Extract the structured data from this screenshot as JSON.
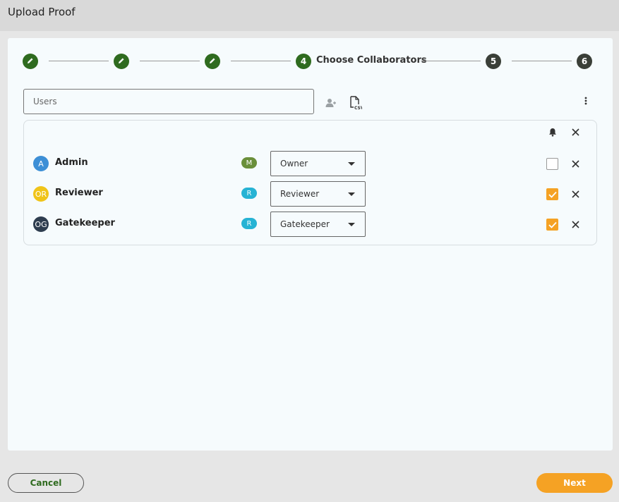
{
  "window": {
    "title": "Upload Proof"
  },
  "stepper": {
    "steps": [
      {
        "number": "1",
        "state": "done",
        "icon": "pencil-icon"
      },
      {
        "number": "2",
        "state": "done",
        "icon": "pencil-icon"
      },
      {
        "number": "3",
        "state": "done",
        "icon": "pencil-icon"
      },
      {
        "number": "4",
        "state": "current",
        "label": "Choose Collaborators"
      },
      {
        "number": "5",
        "state": "todo"
      },
      {
        "number": "6",
        "state": "todo"
      }
    ]
  },
  "search": {
    "placeholder": "Users"
  },
  "toolbar": {
    "icons": [
      "add-user-icon",
      "csv-file-icon",
      "more-vertical-icon"
    ]
  },
  "panel": {
    "header_icons": [
      "bell-icon",
      "close-icon"
    ],
    "collaborators": [
      {
        "initials": "A",
        "name": "Admin",
        "avatar_color": "#3d8fd6",
        "badge": "M",
        "badge_color": "#6a8f3a",
        "role": "Owner",
        "notify": false
      },
      {
        "initials": "OR",
        "name": "Reviewer",
        "avatar_color": "#f0c419",
        "badge": "R",
        "badge_color": "#27b3d4",
        "role": "Reviewer",
        "notify": true
      },
      {
        "initials": "OG",
        "name": "Gatekeeper",
        "avatar_color": "#2e3d4f",
        "badge": "R",
        "badge_color": "#27b3d4",
        "role": "Gatekeeper",
        "notify": true
      }
    ]
  },
  "footer": {
    "cancel_label": "Cancel",
    "next_label": "Next"
  },
  "colors": {
    "accent": "#f5a224",
    "step_done": "#2f6b1f",
    "step_todo": "#3a3f38"
  }
}
